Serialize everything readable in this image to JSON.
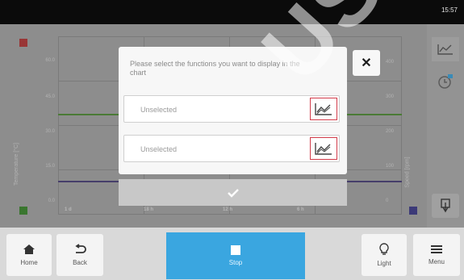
{
  "status_bar": {
    "time": "15:57"
  },
  "chart": {
    "y_left_label": "Temperature [°C]",
    "y_right_label": "Speed [rpm]",
    "y_left_ticks": [
      "60.0",
      "45.0",
      "30.0",
      "15.0",
      "0.0"
    ],
    "y_right_ticks": [
      "400",
      "300",
      "200",
      "100",
      "0"
    ],
    "x_ticks": [
      "1 d",
      "18 h",
      "12 h",
      "6 h"
    ],
    "colors": {
      "temperature": "#4f8f33",
      "speed": "#4a3f7a",
      "alarm": "#b83434"
    }
  },
  "dialog": {
    "message": "Please select the functions you want to display in the chart",
    "rows": [
      {
        "label": "Unselected",
        "icon": "line-chart-icon"
      },
      {
        "label": "Unselected",
        "icon": "line-chart-icon"
      }
    ],
    "close_icon": "close-icon",
    "confirm_icon": "checkmark-icon"
  },
  "side_tools": [
    "chart-view-icon",
    "timer-icon",
    "download-icon"
  ],
  "bottom_nav": {
    "home": "Home",
    "back": "Back",
    "stop": "Stop",
    "light": "Light",
    "menu": "Menu"
  },
  "watermark": "USER"
}
